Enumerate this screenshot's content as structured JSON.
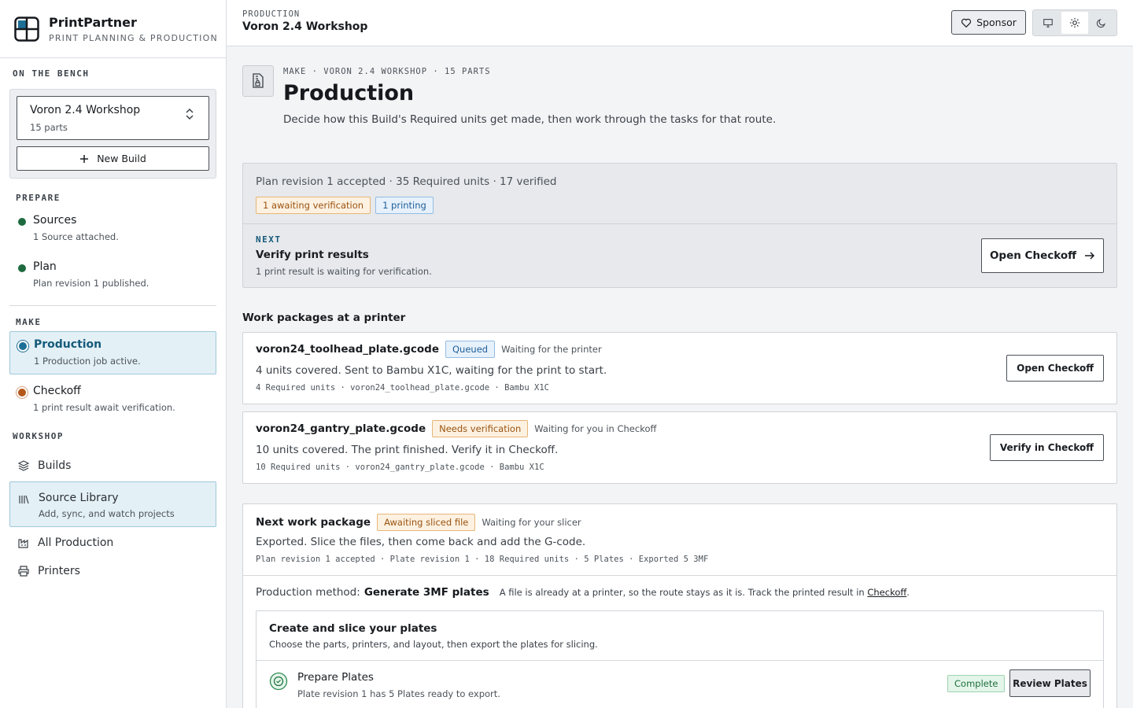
{
  "app": {
    "name": "PrintPartner",
    "tagline": "PRINT PLANNING & PRODUCTION"
  },
  "sidebar": {
    "bench_heading": "ON THE BENCH",
    "build": {
      "name": "Voron 2.4 Workshop",
      "parts": "15 parts"
    },
    "new_build_label": "New Build",
    "prepare_heading": "PREPARE",
    "prepare_steps": [
      {
        "title": "Sources",
        "desc": "1 Source attached.",
        "status_color": "#1e6a3e"
      },
      {
        "title": "Plan",
        "desc": "Plan revision 1 published.",
        "status_color": "#1e6a3e"
      }
    ],
    "make_heading": "MAKE",
    "make_steps": [
      {
        "title": "Production",
        "desc": "1 Production job active.",
        "status_color": "#1d6f96"
      },
      {
        "title": "Checkoff",
        "desc": "1 print result await verification.",
        "status_color": "#b5571a"
      }
    ],
    "workshop_heading": "WORKSHOP",
    "nav": [
      {
        "label": "Builds",
        "icon": "layers-icon"
      },
      {
        "label": "Source Library",
        "sub": "Add, sync, and watch projects",
        "icon": "library-icon"
      },
      {
        "label": "All Production",
        "icon": "factory-icon"
      },
      {
        "label": "Printers",
        "icon": "printer-icon"
      }
    ]
  },
  "topbar": {
    "section": "PRODUCTION",
    "title": "Voron 2.4 Workshop",
    "sponsor_label": "Sponsor",
    "theme_options": [
      "monitor-icon",
      "sun-icon",
      "moon-icon"
    ],
    "theme_selected": "sun-icon"
  },
  "page": {
    "breadcrumb": "MAKE · VORON 2.4 WORKSHOP · 15 PARTS",
    "title": "Production",
    "description": "Decide how this Build's Required units get made, then work through the tasks for that route."
  },
  "summary": {
    "line": "Plan revision 1 accepted · 35 Required units · 17 verified",
    "badges": [
      "1 awaiting verification",
      "1 printing"
    ],
    "next_label": "NEXT",
    "next_title": "Verify print results",
    "next_desc": "1 print result is waiting for verification.",
    "next_button": "Open Checkoff"
  },
  "packages_heading": "Work packages at a printer",
  "packages": [
    {
      "file": "voron24_toolhead_plate.gcode",
      "status": "Queued",
      "wait": "Waiting for the printer",
      "desc": "4 units covered. Sent to Bambu X1C, waiting for the print to start.",
      "meta": "4 Required units · voron24_toolhead_plate.gcode · Bambu X1C",
      "button": "Open Checkoff"
    },
    {
      "file": "voron24_gantry_plate.gcode",
      "status": "Needs verification",
      "wait": "Waiting for you in Checkoff",
      "desc": "10 units covered. The print finished. Verify it in Checkoff.",
      "meta": "10 Required units · voron24_gantry_plate.gcode · Bambu X1C",
      "button": "Verify in Checkoff"
    }
  ],
  "next_package": {
    "title": "Next work package",
    "status": "Awaiting sliced file",
    "wait": "Waiting for your slicer",
    "desc": "Exported. Slice the files, then come back and add the G-code.",
    "meta": "Plan revision 1 accepted · Plate revision 1 · 18 Required units · 5 Plates · Exported 5 3MF",
    "method_label": "Production method:",
    "method_name": "Generate 3MF plates",
    "method_note": "A file is already at a printer, so the route stays as it is. Track the printed result in",
    "method_link": "Checkoff",
    "method_end": ".",
    "slice_title": "Create and slice your plates",
    "slice_desc": "Choose the parts, printers, and layout, then export the plates for slicing.",
    "task": {
      "title": "Prepare Plates",
      "desc": "Plate revision 1 has 5 Plates ready to export.",
      "status": "Complete",
      "button": "Review Plates"
    }
  },
  "colors": {
    "accent": "#155a7a",
    "complete": "#1d6f3c",
    "warning": "#9a5310"
  }
}
